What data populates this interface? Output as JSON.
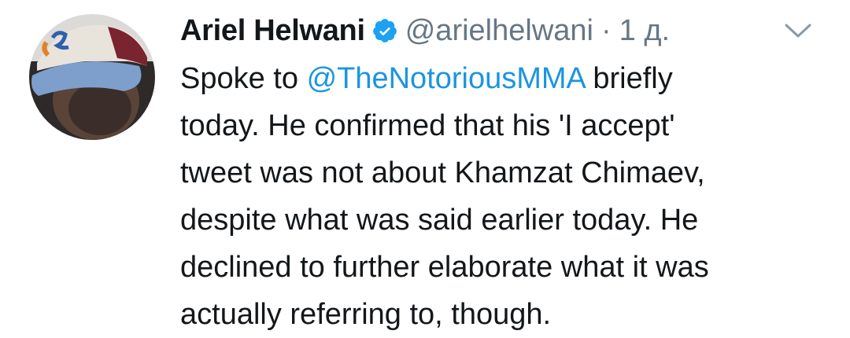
{
  "tweet": {
    "author": {
      "name": "Ariel Helwani",
      "handle": "@arielhelwani",
      "verified_icon": "verified-badge-icon",
      "avatar_icon": "avatar"
    },
    "separator": "·",
    "time": "1 д.",
    "menu_icon": "chevron-down-icon",
    "text": {
      "line1_prefix": "Spoke to ",
      "mention": "@TheNotoriousMMA",
      "line1_suffix": " briefly",
      "line2": "today.  He confirmed that his 'I accept'",
      "line3": "tweet was not about Khamzat Chimaev,",
      "line4": "despite what was said earlier today. He",
      "line5": "declined to further elaborate what it was",
      "line6": "actually referring to, though."
    }
  },
  "colors": {
    "text": "#14171a",
    "secondary": "#657786",
    "link": "#1b95e0",
    "verified": "#1da1f2"
  }
}
